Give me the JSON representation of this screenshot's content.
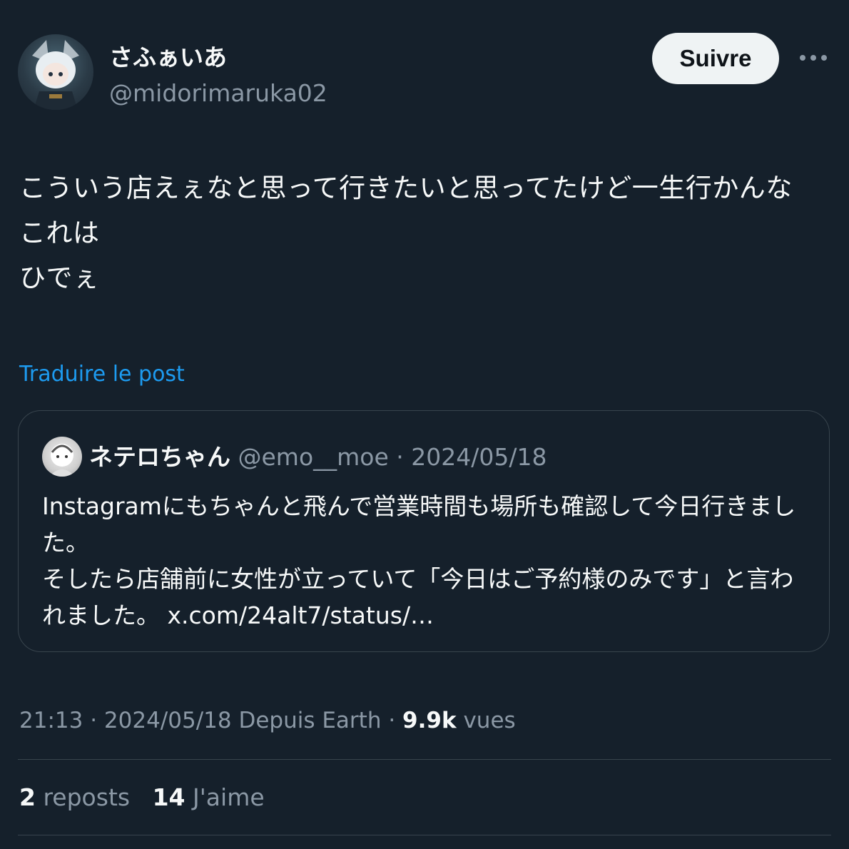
{
  "author": {
    "name": "さふぁいあ",
    "handle": "@midorimaruka02"
  },
  "follow_label": "Suivre",
  "more_icon": "more-horizontal-icon",
  "post": {
    "text": "こういう店えぇなと思って行きたいと思ってたけど一生行かんな\nこれは\nひでぇ"
  },
  "translate_label": "Traduire le post",
  "quote": {
    "name": "ネテロちゃん",
    "handle": "@emo__moe",
    "date": "2024/05/18",
    "separator": " · ",
    "text": "Instagramにもちゃんと飛んで営業時間も場所も確認して今日行きました。\nそしたら店舗前に女性が立っていて「今日はご予約様のみです」と言われました。 x.com/24alt7/status/…"
  },
  "meta": {
    "time": "21:13",
    "date": "2024/05/18",
    "source": "Depuis Earth",
    "views_count": "9.9k",
    "views_label": "vues",
    "separator": " · "
  },
  "stats": {
    "reposts_count": "2",
    "reposts_label": "reposts",
    "likes_count": "14",
    "likes_label": "J'aime"
  },
  "colors": {
    "background": "#15202b",
    "text": "#f7f9f9",
    "secondary": "#8b98a5",
    "link": "#1d9bf0",
    "border": "#38444d",
    "button_bg": "#eff3f4"
  }
}
